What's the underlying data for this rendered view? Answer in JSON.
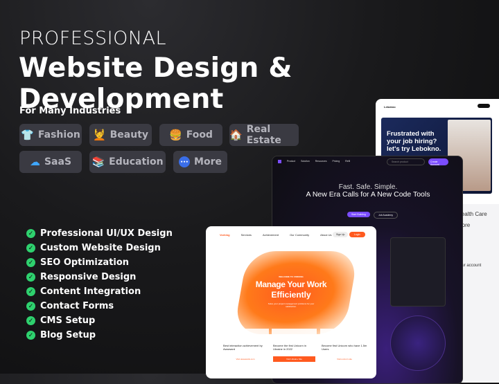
{
  "header": {
    "eyebrow": "PROFESSIONAL",
    "title": "Website Design & Development",
    "industries_label": "For Many Industries"
  },
  "industries": [
    {
      "label": "Fashion",
      "icon": "shirt-icon",
      "glyph": "👕"
    },
    {
      "label": "Beauty",
      "icon": "woman-icon",
      "glyph": "💆"
    },
    {
      "label": "Food",
      "icon": "burger-icon",
      "glyph": "🍔"
    },
    {
      "label": "Real Estate",
      "icon": "house-icon",
      "glyph": "🏠"
    },
    {
      "label": "SaaS",
      "icon": "cloud-icon",
      "glyph": "☁"
    },
    {
      "label": "Education",
      "icon": "books-icon",
      "glyph": "📚"
    },
    {
      "label": "More",
      "icon": "more-icon",
      "glyph": "•••"
    }
  ],
  "services": [
    "Professional UI/UX Design",
    "Custom Website Design",
    "SEO Optimization",
    "Responsive Design",
    "Content Integration",
    "Contact Forms",
    "CMS Setup",
    "Blog Setup"
  ],
  "colors": {
    "check": "#2ed16e",
    "chip_bg": "#3a3a42",
    "orange": "#ff5a1f",
    "purple": "#7b4dff",
    "navy": "#14204a"
  },
  "mock_lebokno": {
    "brand": "Lebokno",
    "headline": "Frustrated with your job hiring? let's try Lebokno.",
    "side1": "Health Care",
    "side2": "More",
    "side3": "your account"
  },
  "mock_code": {
    "nav": [
      "Product",
      "Solution",
      "Resources",
      "Pricing",
      "Refil"
    ],
    "search": "Search product",
    "cta": "Create Account",
    "line1": "Fast. Safe. Simple.",
    "line2": "A New Era Calls for A New Code Tools",
    "primary": "Start Building",
    "secondary": "Job Academy"
  },
  "mock_vorking": {
    "brand": "Vorking",
    "nav": [
      "Services",
      "Achievement",
      "Our Community",
      "About Us"
    ],
    "signup": "Sign Up",
    "login": "Login",
    "eyebrow": "WELCOME TO VORKING",
    "headline1": "Manage Your Work",
    "headline2": "Efficiently",
    "sub": "Solve your project management problems for your satisfaction.",
    "cards": [
      {
        "title": "Best interaction achievement by Awwward",
        "link": "Visit awwwards.com"
      },
      {
        "title": "Become the first Unicorn in Ukraine in 2022",
        "link": "Visit Ukraine Site"
      },
      {
        "title": "Become first Unicorn who have 1.5m Users",
        "link": "Visit unicorn site"
      }
    ]
  }
}
